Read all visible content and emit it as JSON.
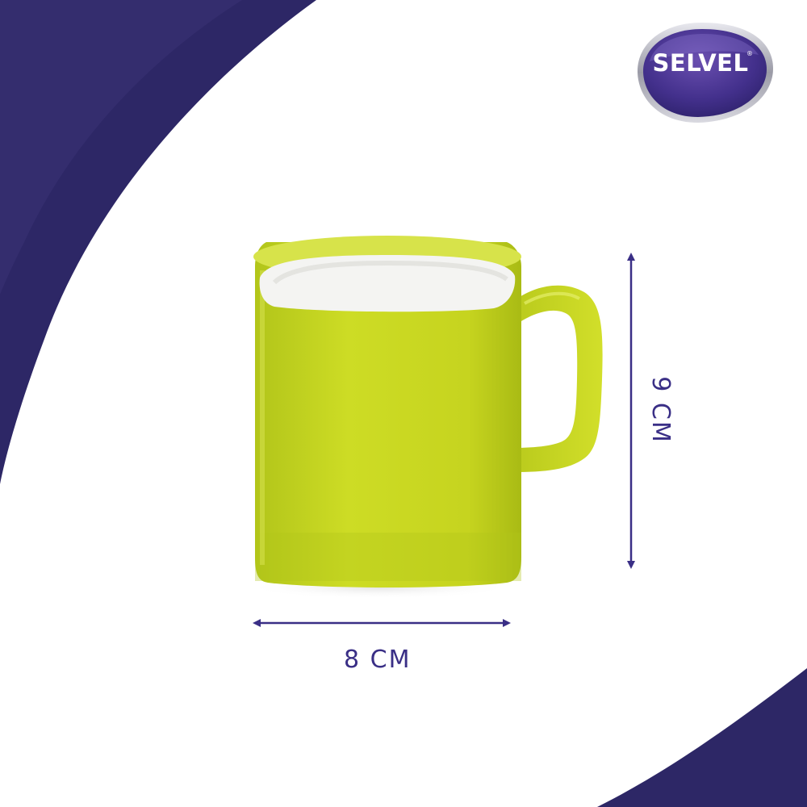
{
  "brand": {
    "name": "SELVEL",
    "registered_mark": "®"
  },
  "dimensions": {
    "width_label": "8 CM",
    "height_label": "9 CM"
  },
  "colors": {
    "background_swoosh": "#2d2766",
    "swoosh_highlight": "#3b3576",
    "mug_body": "#c7d61f",
    "mug_interior": "#f4f4f2",
    "dimension_lines": "#3a2f86",
    "label_text": "#3a2f86",
    "logo_fill": "#43308c",
    "logo_border": "#b9b9c0"
  },
  "icons": {
    "product": "mug-image",
    "dimension_markers": "double-arrow"
  }
}
